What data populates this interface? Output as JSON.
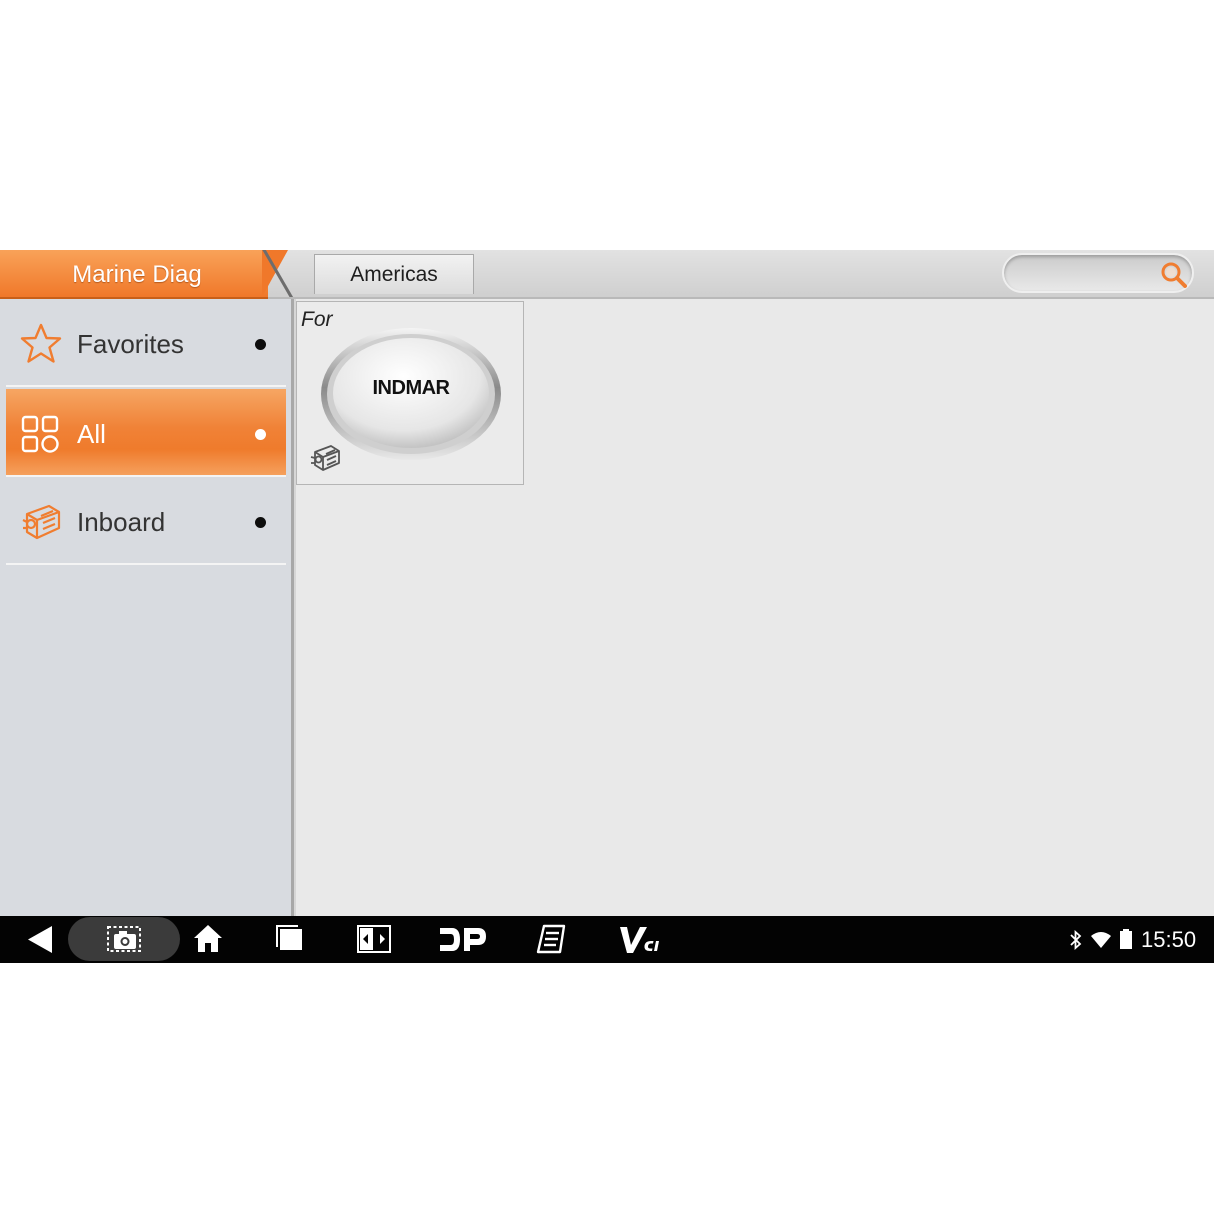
{
  "app": {
    "title": "Marine Diag",
    "accent_color": "#f07d30"
  },
  "header": {
    "region_tab": "Americas",
    "search": {
      "placeholder": "",
      "value": "",
      "icon": "search-icon"
    }
  },
  "sidebar": {
    "items": [
      {
        "label": "Favorites",
        "icon": "star-icon",
        "active": false
      },
      {
        "label": "All",
        "icon": "grid-icon",
        "active": true
      },
      {
        "label": "Inboard",
        "icon": "engine-icon",
        "active": false
      }
    ]
  },
  "content": {
    "brands": [
      {
        "prefix": "For",
        "name": "INDMAR",
        "icon": "engine-icon"
      }
    ]
  },
  "navbar": {
    "buttons": [
      "back-icon",
      "screenshot-icon",
      "home-icon",
      "recent-apps-icon",
      "display-toggle-icon",
      "dp-icon",
      "notes-icon",
      "vci-icon"
    ],
    "vci_label": "VCI",
    "dp_label": "DP",
    "status": {
      "bluetooth": "bluetooth-icon",
      "wifi": "wifi-icon",
      "battery": "battery-icon",
      "time": "15:50"
    }
  }
}
